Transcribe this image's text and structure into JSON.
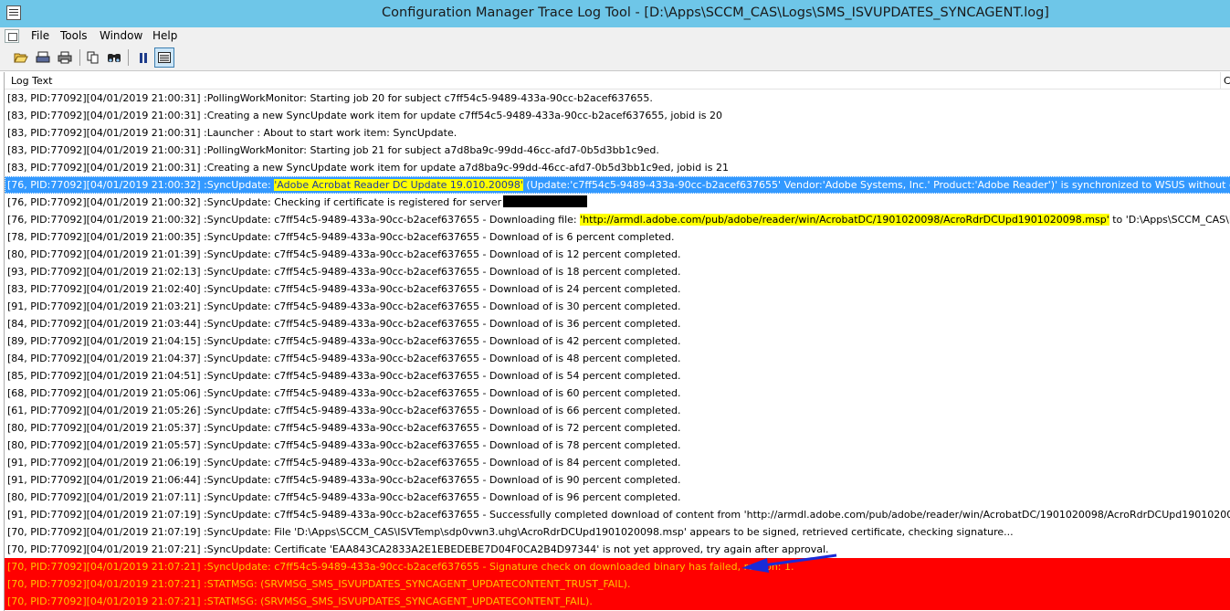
{
  "window": {
    "title": "Configuration Manager Trace Log Tool - [D:\\Apps\\SCCM_CAS\\Logs\\SMS_ISVUPDATES_SYNCAGENT.log]"
  },
  "menu": {
    "file": "File",
    "tools": "Tools",
    "window": "Window",
    "help": "Help"
  },
  "toolbar": {
    "icons": [
      "open-icon",
      "print-preview-icon",
      "print-icon",
      "copy-icon",
      "find-icon",
      "pause-icon",
      "window-list-icon"
    ]
  },
  "list": {
    "column_log_text": "Log Text",
    "column_edge": "C"
  },
  "rows": [
    {
      "text": "[83, PID:77092][04/01/2019 21:00:31] :PollingWorkMonitor: Starting job 20 for subject c7ff54c5-9489-433a-90cc-b2acef637655."
    },
    {
      "text": "[83, PID:77092][04/01/2019 21:00:31] :Creating a new SyncUpdate work item for update c7ff54c5-9489-433a-90cc-b2acef637655, jobid is 20"
    },
    {
      "text": "[83, PID:77092][04/01/2019 21:00:31] :Launcher : About to start work item: SyncUpdate."
    },
    {
      "text": "[83, PID:77092][04/01/2019 21:00:31] :PollingWorkMonitor: Starting job 21 for subject a7d8ba9c-99dd-46cc-afd7-0b5d3bb1c9ed."
    },
    {
      "text": "[83, PID:77092][04/01/2019 21:00:31] :Creating a new SyncUpdate work item for update a7d8ba9c-99dd-46cc-afd7-0b5d3bb1c9ed, jobid is 21"
    },
    {
      "pre": "[76, PID:77092][04/01/2019 21:00:32] :SyncUpdate: ",
      "highlight": "'Adobe Acrobat Reader DC Update 19.010.20098'",
      "post": " (Update:'c7ff54c5-9489-433a-90cc-b2acef637655' Vendor:'Adobe Systems, Inc.' Product:'Adobe Reader')' is synchronized to WSUS without content, revis..."
    },
    {
      "pre": "[76, PID:77092][04/01/2019 21:00:32] :SyncUpdate: Checking if certificate is registered for server",
      "redacted": true
    },
    {
      "pre": "[76, PID:77092][04/01/2019 21:00:32] :SyncUpdate: c7ff54c5-9489-433a-90cc-b2acef637655 - Downloading file: ",
      "highlight": "'http://armdl.adobe.com/pub/adobe/reader/win/AcrobatDC/1901020098/AcroRdrDCUpd1901020098.msp'",
      "post": " to 'D:\\Apps\\SCCM_CAS\\ISVTem..."
    },
    {
      "text": "[78, PID:77092][04/01/2019 21:00:35] :SyncUpdate: c7ff54c5-9489-433a-90cc-b2acef637655 - Download of is 6 percent completed."
    },
    {
      "text": "[80, PID:77092][04/01/2019 21:01:39] :SyncUpdate: c7ff54c5-9489-433a-90cc-b2acef637655 - Download of is 12 percent completed."
    },
    {
      "text": "[93, PID:77092][04/01/2019 21:02:13] :SyncUpdate: c7ff54c5-9489-433a-90cc-b2acef637655 - Download of is 18 percent completed."
    },
    {
      "text": "[83, PID:77092][04/01/2019 21:02:40] :SyncUpdate: c7ff54c5-9489-433a-90cc-b2acef637655 - Download of is 24 percent completed."
    },
    {
      "text": "[91, PID:77092][04/01/2019 21:03:21] :SyncUpdate: c7ff54c5-9489-433a-90cc-b2acef637655 - Download of is 30 percent completed."
    },
    {
      "text": "[84, PID:77092][04/01/2019 21:03:44] :SyncUpdate: c7ff54c5-9489-433a-90cc-b2acef637655 - Download of is 36 percent completed."
    },
    {
      "text": "[89, PID:77092][04/01/2019 21:04:15] :SyncUpdate: c7ff54c5-9489-433a-90cc-b2acef637655 - Download of is 42 percent completed."
    },
    {
      "text": "[84, PID:77092][04/01/2019 21:04:37] :SyncUpdate: c7ff54c5-9489-433a-90cc-b2acef637655 - Download of is 48 percent completed."
    },
    {
      "text": "[85, PID:77092][04/01/2019 21:04:51] :SyncUpdate: c7ff54c5-9489-433a-90cc-b2acef637655 - Download of is 54 percent completed."
    },
    {
      "text": "[68, PID:77092][04/01/2019 21:05:06] :SyncUpdate: c7ff54c5-9489-433a-90cc-b2acef637655 - Download of is 60 percent completed."
    },
    {
      "text": "[61, PID:77092][04/01/2019 21:05:26] :SyncUpdate: c7ff54c5-9489-433a-90cc-b2acef637655 - Download of is 66 percent completed."
    },
    {
      "text": "[80, PID:77092][04/01/2019 21:05:37] :SyncUpdate: c7ff54c5-9489-433a-90cc-b2acef637655 - Download of is 72 percent completed."
    },
    {
      "text": "[80, PID:77092][04/01/2019 21:05:57] :SyncUpdate: c7ff54c5-9489-433a-90cc-b2acef637655 - Download of is 78 percent completed."
    },
    {
      "text": "[91, PID:77092][04/01/2019 21:06:19] :SyncUpdate: c7ff54c5-9489-433a-90cc-b2acef637655 - Download of is 84 percent completed."
    },
    {
      "text": "[91, PID:77092][04/01/2019 21:06:44] :SyncUpdate: c7ff54c5-9489-433a-90cc-b2acef637655 - Download of is 90 percent completed."
    },
    {
      "text": "[80, PID:77092][04/01/2019 21:07:11] :SyncUpdate: c7ff54c5-9489-433a-90cc-b2acef637655 - Download of is 96 percent completed."
    },
    {
      "text": "[91, PID:77092][04/01/2019 21:07:19] :SyncUpdate: c7ff54c5-9489-433a-90cc-b2acef637655 - Successfully completed download of content from 'http://armdl.adobe.com/pub/adobe/reader/win/AcrobatDC/1901020098/AcroRdrDCUpd1901020098.msp' ..."
    },
    {
      "text": "[70, PID:77092][04/01/2019 21:07:19] :SyncUpdate: File 'D:\\Apps\\SCCM_CAS\\ISVTemp\\sdp0vwn3.uhg\\AcroRdrDCUpd1901020098.msp' appears to be signed, retrieved certificate, checking signature..."
    },
    {
      "text": "[70, PID:77092][04/01/2019 21:07:21] :SyncUpdate: Certificate 'EAA843CA2833A2E1EBEDEBE7D04F0CA2B4D97344' is not yet approved, try again after approval."
    },
    {
      "text": "[70, PID:77092][04/01/2019 21:07:21] :SyncUpdate: c7ff54c5-9489-433a-90cc-b2acef637655 - Signature check on downloaded binary has failed, reason: 1.",
      "error": true
    },
    {
      "text": "[70, PID:77092][04/01/2019 21:07:21] :STATMSG: (SRVMSG_SMS_ISVUPDATES_SYNCAGENT_UPDATECONTENT_TRUST_FAIL).",
      "error": true
    },
    {
      "text": "[70, PID:77092][04/01/2019 21:07:21] :STATMSG: (SRVMSG_SMS_ISVUPDATES_SYNCAGENT_UPDATECONTENT_FAIL).",
      "error": true
    }
  ],
  "selected_row": 5,
  "colors": {
    "titlebar": "#6ec6e8",
    "selection": "#3399ff",
    "highlight": "#ffff00",
    "error_bg": "#ff0000",
    "error_text": "#ffd200",
    "annotation_arrow": "#1a2bd6"
  }
}
